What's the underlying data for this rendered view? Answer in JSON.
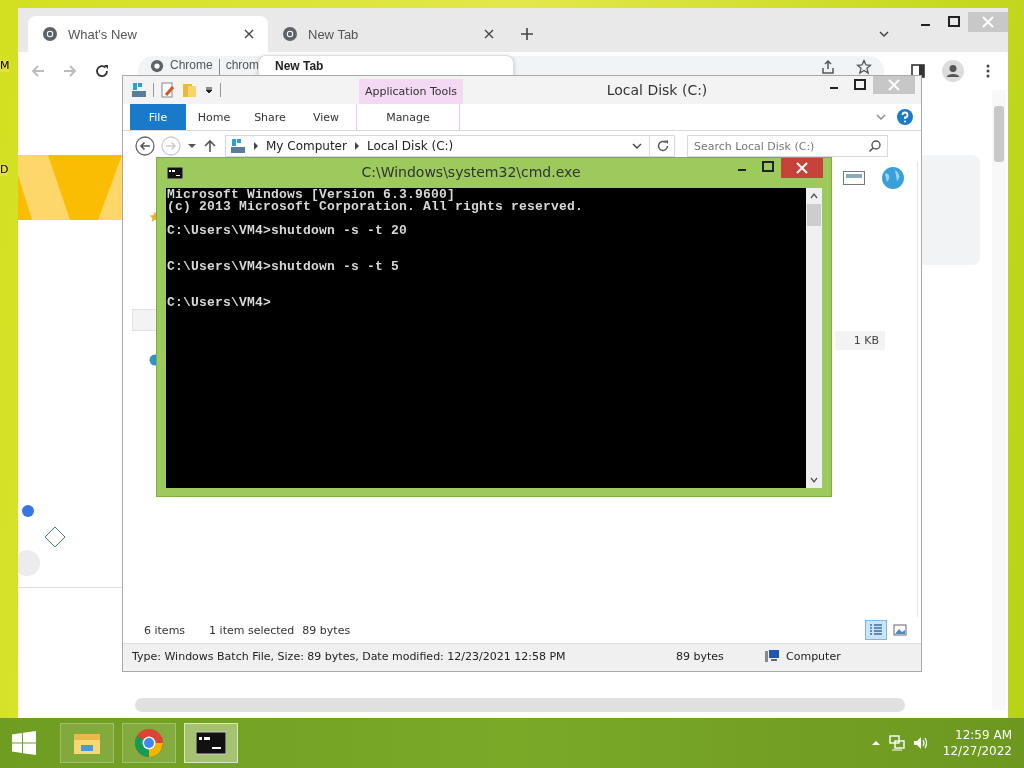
{
  "desktop": {
    "icon_labels": [
      "M",
      "D"
    ]
  },
  "browser": {
    "tabs": [
      {
        "title": "What's New",
        "selected": true
      },
      {
        "title": "New Tab",
        "selected": false
      }
    ],
    "site_chip": "Chrome",
    "address": "chrom",
    "hover_card": "New Tab"
  },
  "explorer": {
    "title": "Local Disk (C:)",
    "context_group": "Application Tools",
    "ribbon_tabs": [
      {
        "label": "File",
        "kind": "file"
      },
      {
        "label": "Home",
        "kind": "plain"
      },
      {
        "label": "Share",
        "kind": "plain"
      },
      {
        "label": "View",
        "kind": "plain"
      },
      {
        "label": "Manage",
        "kind": "context"
      }
    ],
    "breadcrumb": [
      "My Computer",
      "Local Disk (C:)"
    ],
    "search": {
      "placeholder": "Search Local Disk (C:)"
    },
    "file_size": "1 KB",
    "item_count": "6 items",
    "selection": "1 item selected",
    "selection_size": "89 bytes",
    "views": [
      {
        "kind": "details",
        "selected": true
      },
      {
        "kind": "large_icons",
        "selected": false
      }
    ],
    "status_bar": {
      "details": "Type: Windows Batch File, Size: 89 bytes, Date modified: 12/23/2021 12:58 PM",
      "size": "89 bytes",
      "location": "Computer"
    }
  },
  "console": {
    "title": "C:\\Windows\\system32\\cmd.exe",
    "output": "Microsoft Windows [Version 6.3.9600]\n(c) 2013 Microsoft Corporation. All rights reserved.\n\nC:\\Users\\VM4>shutdown -s -t 20\n\n\nC:\\Users\\VM4>shutdown -s -t 5\n\n\nC:\\Users\\VM4>"
  },
  "taskbar": {
    "apps": [
      {
        "kind": "explorer",
        "active": false
      },
      {
        "kind": "chrome",
        "active": false
      },
      {
        "kind": "console",
        "active": true
      }
    ],
    "time": "12:59 AM",
    "date": "12/27/2022"
  }
}
